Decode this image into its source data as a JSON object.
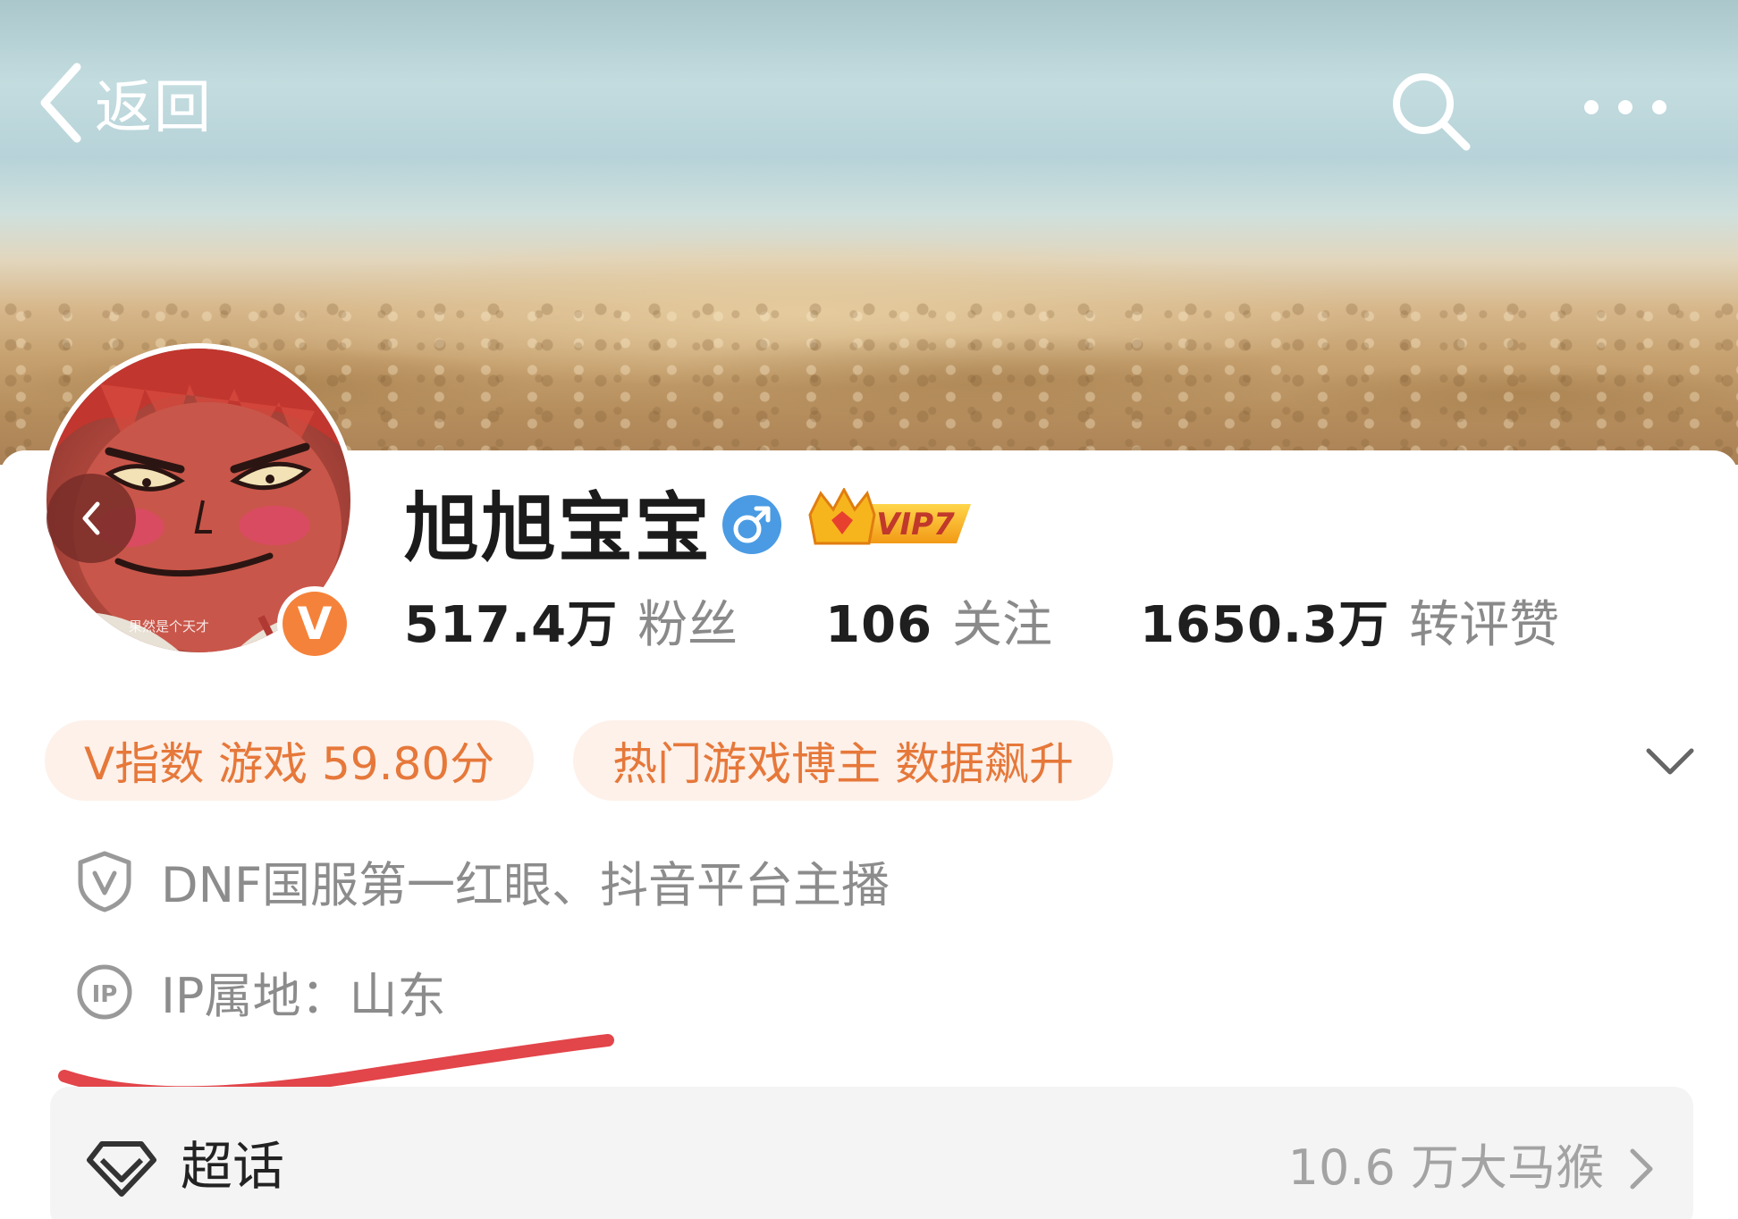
{
  "header": {
    "back_label": "返回"
  },
  "profile": {
    "avatar_caption": "果然是个天才",
    "name": "旭旭宝宝",
    "gender": "male",
    "vip_label": "VIP7",
    "verified_badge": "V",
    "stats": [
      {
        "value": "517.4万",
        "label": "粉丝"
      },
      {
        "value": "106",
        "label": "关注"
      },
      {
        "value": "1650.3万",
        "label": "转评赞"
      }
    ]
  },
  "tags": [
    {
      "text": "V指数 游戏 59.80分"
    },
    {
      "text": "热门游戏博主 数据飙升"
    }
  ],
  "info": {
    "certification": "DNF国服第一红眼、抖音平台主播",
    "ip_location": "IP属地：山东"
  },
  "supertopic": {
    "label": "超话",
    "count_text": "10.6 万大马猴"
  },
  "colors": {
    "accent_orange": "#e6783a",
    "tag_bg": "#fdf1ea",
    "gender_blue": "#4a9be3",
    "annotation_red": "#e2454a",
    "vip_gold": "#f3a51c"
  },
  "icons": {
    "back": "chevron-left-icon",
    "search": "search-icon",
    "more": "more-dots-icon",
    "gender": "male-icon",
    "certification": "shield-v-icon",
    "ip": "ip-icon",
    "supertopic": "diamond-icon",
    "expand": "chevron-down-icon",
    "row_arrow": "chevron-right-icon"
  }
}
